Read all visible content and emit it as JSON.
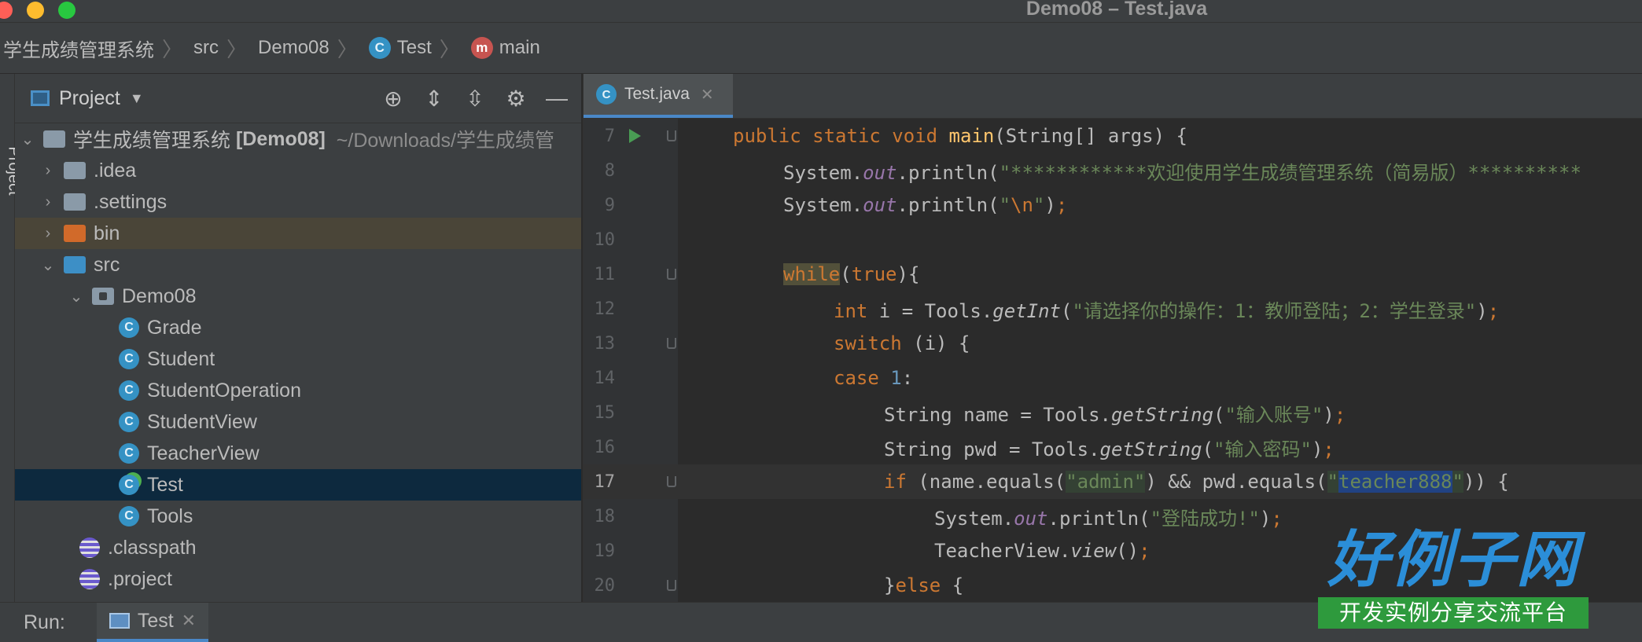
{
  "window": {
    "title": "Demo08 – Test.java"
  },
  "breadcrumb": {
    "items": [
      {
        "label": "学生成绩管理系统",
        "icon": ""
      },
      {
        "label": "src",
        "icon": ""
      },
      {
        "label": "Demo08",
        "icon": ""
      },
      {
        "label": "Test",
        "icon": "class-icon"
      },
      {
        "label": "main",
        "icon": "method-icon"
      }
    ]
  },
  "left_strip": {
    "label": "Project"
  },
  "project_panel": {
    "title": "Project",
    "tree": {
      "root": {
        "name": "学生成绩管理系统",
        "module": "[Demo08]",
        "path": "~/Downloads/学生成绩管"
      },
      "idea": ".idea",
      "settings": ".settings",
      "bin": "bin",
      "src": "src",
      "package": "Demo08",
      "classes": [
        "Grade",
        "Student",
        "StudentOperation",
        "StudentView",
        "TeacherView",
        "Test",
        "Tools"
      ],
      "classpath": ".classpath",
      "project": ".project"
    }
  },
  "editor": {
    "tab": "Test.java",
    "lines": [
      {
        "n": "7"
      },
      {
        "n": "8",
        "str": "\"************欢迎使用学生成绩管理系统（简易版）**********"
      },
      {
        "n": "9"
      },
      {
        "n": "10"
      },
      {
        "n": "11"
      },
      {
        "n": "12",
        "str": "\"请选择你的操作：1：教师登陆；2：学生登录\""
      },
      {
        "n": "13"
      },
      {
        "n": "14",
        "num": "1"
      },
      {
        "n": "15",
        "str": "\"输入账号\""
      },
      {
        "n": "16",
        "str": "\"输入密码\""
      },
      {
        "n": "17",
        "str1": "\"admin\"",
        "str2": "teacher888"
      },
      {
        "n": "18",
        "str": "\"登陆成功!\""
      },
      {
        "n": "19"
      },
      {
        "n": "20"
      }
    ]
  },
  "run_bar": {
    "label": "Run:",
    "tab": "Test"
  },
  "watermark": {
    "big": "好例子网",
    "small": "开发实例分享交流平台"
  },
  "colors": {
    "accent": "#4a88c7",
    "background": "#2b2b2b",
    "panel": "#3c3f41",
    "keyword": "#cc7832",
    "string": "#6a8759"
  }
}
